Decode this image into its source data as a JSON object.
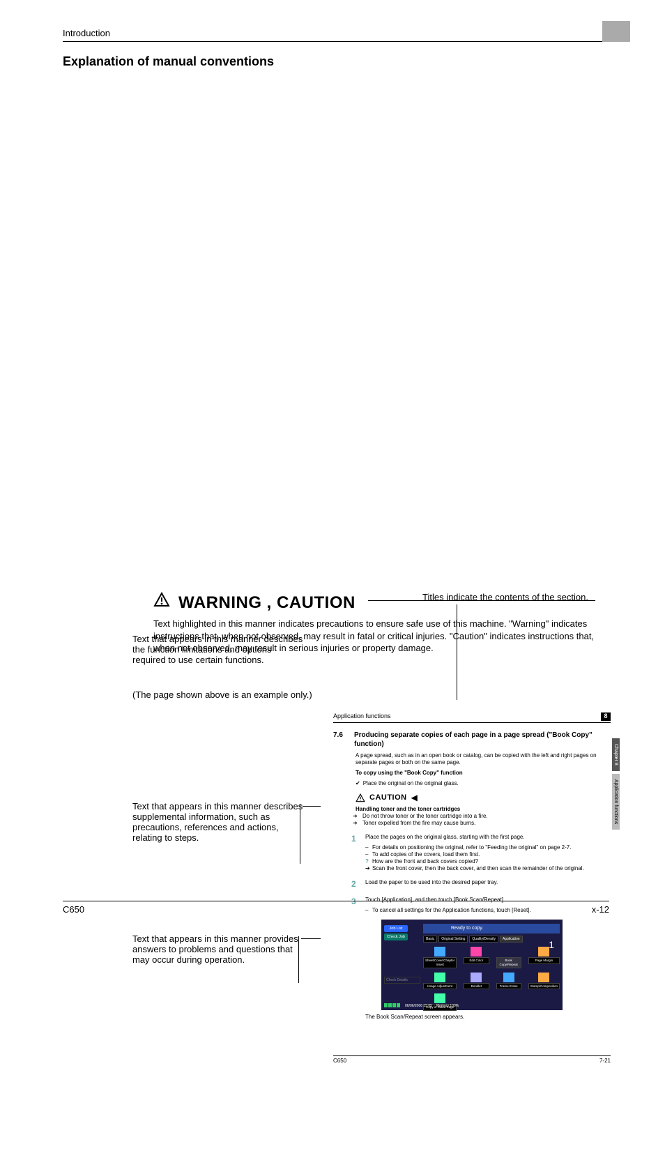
{
  "header": {
    "section": "Introduction"
  },
  "title": "Explanation of manual conventions",
  "titles_note": "Titles indicate the contents of the section.",
  "annotations": {
    "a1": "Text that appears in this manner describes the function limitations and options required to use certain functions.",
    "a2": "Text that appears in this manner describes supplemental information, such as precautions, references and actions, relating to steps.",
    "a3": "Text that appears in this manner provides answers to problems and questions that may occur during operation."
  },
  "inset": {
    "app_header": "Application functions",
    "chapter_num": "8",
    "side_tabs": [
      "Chapter 8",
      "Application functions"
    ],
    "sec_num": "7.6",
    "sec_title": "Producing separate copies of each page in a page spread (\"Book Copy\" function)",
    "intro": "A page spread, such as in an open book or catalog, can be copied with the left and right pages on separate pages or both on the same page.",
    "sub_b": "To copy using the \"Book Copy\" function",
    "check_line": "Place the original on the original glass.",
    "caution_label": "CAUTION",
    "caut_sub": "Handling toner and the toner cartridges",
    "caut_l1": "Do not throw toner or the toner cartridge into a fire.",
    "caut_l2": "Toner expelled from the fire may cause burns.",
    "step1_n": "1",
    "step1_t": "Place the pages on the original glass, starting with the first page.",
    "step1_s1": "For details on positioning the original, refer to \"Feeding the original\" on page 2-7.",
    "step1_s2": "To add copies of the covers, load them first.",
    "step1_q": "How are the front and back covers copied?",
    "step1_qa": "Scan the front cover, then the back cover, and then scan the remainder of the original.",
    "step2_n": "2",
    "step2_t": "Load the paper to be used into the desired paper tray.",
    "step3_n": "3",
    "step3_t": "Touch [Application], and then touch [Book Scan/Repeat].",
    "step3_s1": "To cancel all settings for the Application functions, touch [Reset].",
    "panel": {
      "ready": "Ready to copy.",
      "one": "1",
      "left_btns": [
        "Job List",
        "Check Job"
      ],
      "left_caption": "Check Details",
      "tabs": [
        "Basic",
        "Original Setting",
        "Quality/Density",
        "Application"
      ],
      "grid": [
        {
          "lbl": "Sheet/Cover/Chapter Insert"
        },
        {
          "lbl": "Edit Color"
        },
        {
          "lbl": "Book Copy/Repeat"
        },
        {
          "lbl": "Page Margin"
        },
        {
          "lbl": "Image Adjustment"
        },
        {
          "lbl": "Booklet"
        },
        {
          "lbl": "Frame Erase"
        },
        {
          "lbl": "Stamp/Composition"
        },
        {
          "lbl": "Copy in Ruled Page"
        }
      ],
      "footer_date": "06/06/2006  15:05",
      "footer_mem": "Memory   100%"
    },
    "after_panel": "The Book Scan/Repeat screen appears.",
    "foot_model": "C650",
    "foot_page": "7-21"
  },
  "warn": {
    "heading": "WARNING , CAUTION",
    "body": "Text highlighted in this manner indicates precautions to ensure safe use of this machine. \"Warning\" indicates instructions that, when not observed, may result in fatal or critical injuries. \"Caution\" indicates instructions that, when not observed, may result in serious injuries or property damage."
  },
  "example_note": "(The page shown above is an example only.)",
  "footer": {
    "model": "C650",
    "page": "x-12"
  }
}
